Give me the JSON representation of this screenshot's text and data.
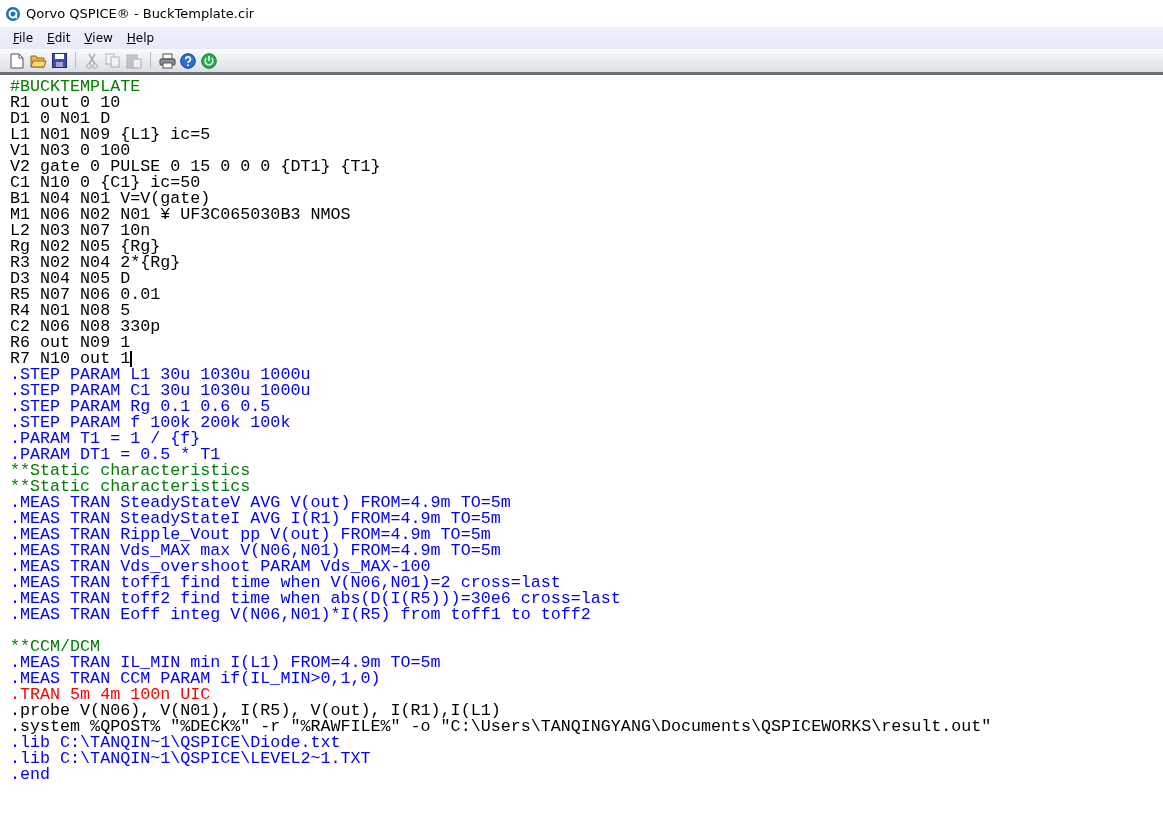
{
  "window": {
    "title": "Qorvo QSPICE® - BuckTemplate.cir"
  },
  "menu": [
    {
      "label": "File"
    },
    {
      "label": "Edit"
    },
    {
      "label": "View"
    },
    {
      "label": "Help"
    }
  ],
  "toolbar": [
    {
      "kind": "new",
      "disabled": false
    },
    {
      "kind": "open",
      "disabled": false
    },
    {
      "kind": "save",
      "disabled": false
    },
    {
      "kind": "separator"
    },
    {
      "kind": "cut",
      "disabled": true
    },
    {
      "kind": "copy",
      "disabled": true
    },
    {
      "kind": "paste",
      "disabled": true
    },
    {
      "kind": "separator"
    },
    {
      "kind": "print",
      "disabled": false
    },
    {
      "kind": "help",
      "disabled": false
    },
    {
      "kind": "run",
      "disabled": false
    }
  ],
  "editor": {
    "lines": [
      {
        "kind": "comment",
        "text": "#BUCKTEMPLATE"
      },
      {
        "kind": "netlist",
        "text": "R1 out 0 10"
      },
      {
        "kind": "netlist",
        "text": "D1 0 N01 D"
      },
      {
        "kind": "netlist",
        "text": "L1 N01 N09 {L1} ic=5"
      },
      {
        "kind": "netlist",
        "text": "V1 N03 0 100"
      },
      {
        "kind": "netlist",
        "text": "V2 gate 0 PULSE 0 15 0 0 0 {DT1} {T1}"
      },
      {
        "kind": "netlist",
        "text": "C1 N10 0 {C1} ic=50"
      },
      {
        "kind": "netlist",
        "text": "B1 N04 N01 V=V(gate)"
      },
      {
        "kind": "netlist",
        "text": "M1 N06 N02 N01 ¥ UF3C065030B3 NMOS"
      },
      {
        "kind": "netlist",
        "text": "L2 N03 N07 10n"
      },
      {
        "kind": "netlist",
        "text": "Rg N02 N05 {Rg}"
      },
      {
        "kind": "netlist",
        "text": "R3 N02 N04 2*{Rg}"
      },
      {
        "kind": "netlist",
        "text": "D3 N04 N05 D"
      },
      {
        "kind": "netlist",
        "text": "R5 N07 N06 0.01"
      },
      {
        "kind": "netlist",
        "text": "R4 N01 N08 5"
      },
      {
        "kind": "netlist",
        "text": "C2 N06 N08 330p"
      },
      {
        "kind": "netlist",
        "text": "R6 out N09 1"
      },
      {
        "kind": "netlist",
        "text": "R7 N10 out 1",
        "cursor": true
      },
      {
        "kind": "directive",
        "text": ".STEP PARAM L1 30u 1030u 1000u"
      },
      {
        "kind": "directive",
        "text": ".STEP PARAM C1 30u 1030u 1000u"
      },
      {
        "kind": "directive",
        "text": ".STEP PARAM Rg 0.1 0.6 0.5"
      },
      {
        "kind": "directive",
        "text": ".STEP PARAM f 100k 200k 100k"
      },
      {
        "kind": "directive",
        "text": ".PARAM T1 = 1 / {f}"
      },
      {
        "kind": "directive",
        "text": ".PARAM DT1 = 0.5 * T1"
      },
      {
        "kind": "comment",
        "text": "**Static characteristics"
      },
      {
        "kind": "comment",
        "text": "**Static characteristics"
      },
      {
        "kind": "directive",
        "text": ".MEAS TRAN SteadyStateV AVG V(out) FROM=4.9m TO=5m"
      },
      {
        "kind": "directive",
        "text": ".MEAS TRAN SteadyStateI AVG I(R1) FROM=4.9m TO=5m"
      },
      {
        "kind": "directive",
        "text": ".MEAS TRAN Ripple_Vout pp V(out) FROM=4.9m TO=5m"
      },
      {
        "kind": "directive",
        "text": ".MEAS TRAN Vds_MAX max V(N06,N01) FROM=4.9m TO=5m"
      },
      {
        "kind": "directive",
        "text": ".MEAS TRAN Vds_overshoot PARAM Vds_MAX-100"
      },
      {
        "kind": "directive",
        "text": ".MEAS TRAN toff1 find time when V(N06,N01)=2 cross=last"
      },
      {
        "kind": "directive",
        "text": ".MEAS TRAN toff2 find time when abs(D(I(R5)))=30e6 cross=last"
      },
      {
        "kind": "directive",
        "text": ".MEAS TRAN Eoff integ V(N06,N01)*I(R5) from toff1 to toff2"
      },
      {
        "kind": "blank"
      },
      {
        "kind": "comment",
        "text": "**CCM/DCM"
      },
      {
        "kind": "directive",
        "text": ".MEAS TRAN IL_MIN min I(L1) FROM=4.9m TO=5m"
      },
      {
        "kind": "directive",
        "text": ".MEAS TRAN CCM PARAM if(IL_MIN>0,1,0)"
      },
      {
        "kind": "analysis",
        "text": ".TRAN 5m 4m 100n UIC"
      },
      {
        "kind": "netlist",
        "text": ".probe V(N06), V(N01), I(R5), V(out), I(R1),I(L1)"
      },
      {
        "kind": "netlist",
        "text": ".system %QPOST% \"%DECK%\" -r \"%RAWFILE%\" -o \"C:\\Users\\TANQINGYANG\\Documents\\QSPICEWORKS\\result.out\""
      },
      {
        "kind": "directive",
        "text": ".lib C:\\TANQIN~1\\QSPICE\\Diode.txt"
      },
      {
        "kind": "directive",
        "text": ".lib C:\\TANQIN~1\\QSPICE\\LEVEL2~1.TXT"
      },
      {
        "kind": "directive",
        "text": ".end"
      }
    ]
  }
}
